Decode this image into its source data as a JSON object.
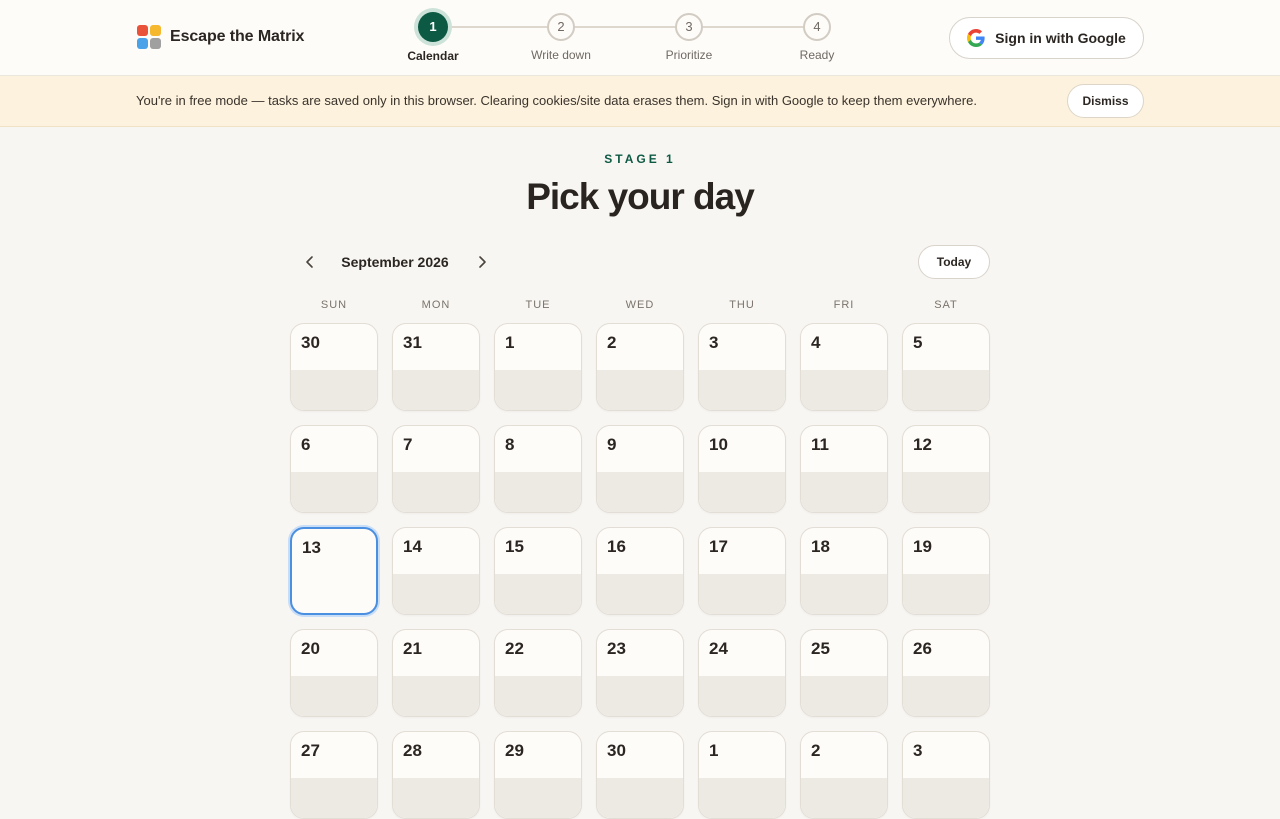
{
  "app": {
    "name": "Escape the Matrix",
    "logo_colors": [
      "#e8533a",
      "#f5b82e",
      "#4aa3e8",
      "#a0a0a0"
    ]
  },
  "stepper": {
    "steps": [
      {
        "number": "1",
        "label": "Calendar",
        "active": true
      },
      {
        "number": "2",
        "label": "Write down",
        "active": false
      },
      {
        "number": "3",
        "label": "Prioritize",
        "active": false
      },
      {
        "number": "4",
        "label": "Ready",
        "active": false
      }
    ]
  },
  "header": {
    "signin_label": "Sign in with Google",
    "signin_icon": "google-g-icon"
  },
  "banner": {
    "text": "You're in free mode — tasks are saved only in this browser. Clearing cookies/site data erases them. Sign in with Google to keep them everywhere.",
    "dismiss_label": "Dismiss"
  },
  "main": {
    "stage_label": "STAGE 1",
    "title": "Pick your day"
  },
  "calendar": {
    "month_label": "September 2026",
    "prev_icon": "chevron-left-icon",
    "next_icon": "chevron-right-icon",
    "today_label": "Today",
    "weekdays": [
      "SUN",
      "MON",
      "TUE",
      "WED",
      "THU",
      "FRI",
      "SAT"
    ],
    "selected_day": "13",
    "days": [
      "30",
      "31",
      "1",
      "2",
      "3",
      "4",
      "5",
      "6",
      "7",
      "8",
      "9",
      "10",
      "11",
      "12",
      "13",
      "14",
      "15",
      "16",
      "17",
      "18",
      "19",
      "20",
      "21",
      "22",
      "23",
      "24",
      "25",
      "26",
      "27",
      "28",
      "29",
      "30",
      "1",
      "2",
      "3"
    ]
  },
  "colors": {
    "accent": "#0d5a44",
    "selection": "#4a8fe0",
    "banner_bg": "#fdf2dd"
  }
}
